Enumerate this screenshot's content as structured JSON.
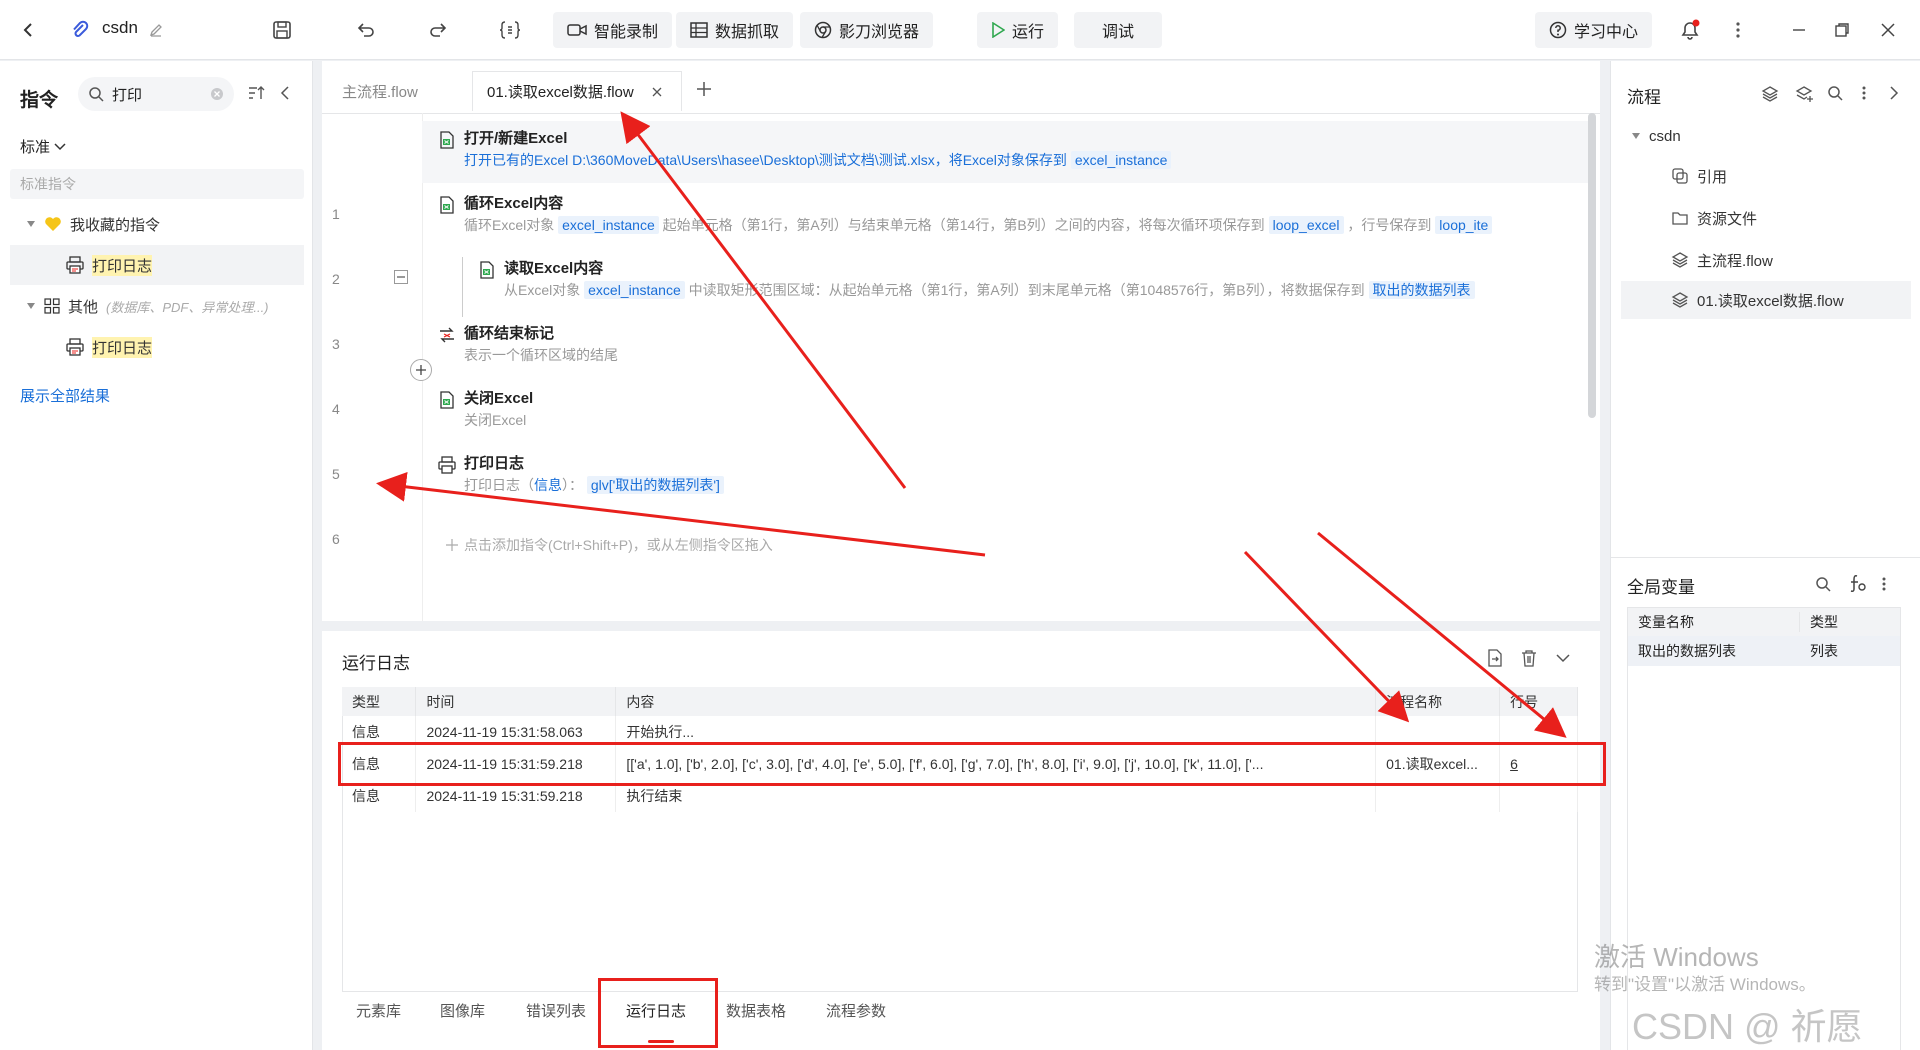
{
  "header": {
    "project_name": "csdn",
    "buttons": {
      "record": "智能录制",
      "data_capture": "数据抓取",
      "browser": "影刀浏览器",
      "run": "运行",
      "debug": "调试",
      "learn": "学习中心"
    }
  },
  "left": {
    "title": "指令",
    "search_value": "打印",
    "filter": "标准",
    "section_label": "标准指令",
    "favorites_label": "我收藏的指令",
    "fav_item": "打印日志",
    "other_label": "其他",
    "other_hint": "(数据库、PDF、异常处理...)",
    "other_item": "打印日志",
    "show_all": "展示全部结果"
  },
  "tabs": [
    {
      "label": "主流程.flow"
    },
    {
      "label": "01.读取excel数据.flow"
    }
  ],
  "steps": [
    {
      "num": "1",
      "title": "打开/新建Excel",
      "desc": "打开已有的Excel D:\\360MoveData\\Users\\hasee\\Desktop\\测试文档\\测试.xlsx，将Excel对象保存到",
      "var1": "excel_instance"
    },
    {
      "num": "2",
      "title": "循环Excel内容",
      "desc": "循环Excel对象",
      "var1": "excel_instance",
      "desc2": "起始单元格（第1行，第A列）与结束单元格（第14行，第B列）之间的内容，将每次循环项保存到",
      "var2": "loop_excel",
      "desc3": "，行号保存到",
      "var3": "loop_ite"
    },
    {
      "num": "3",
      "title": "读取Excel内容",
      "desc": "从Excel对象",
      "var1": "excel_instance",
      "desc2": "中读取矩形范围区域：从起始单元格（第1行，第A列）到末尾单元格（第1048576行，第B列），将数据保存到",
      "var2": "取出的数据列表"
    },
    {
      "num": "4",
      "title": "循环结束标记",
      "desc": "表示一个循环区域的结尾"
    },
    {
      "num": "5",
      "title": "关闭Excel",
      "desc": "关闭Excel"
    },
    {
      "num": "6",
      "title": "打印日志",
      "desc": "打印日志（",
      "var1": "信息",
      "desc2": "）：",
      "var2": "glv['取出的数据列表']"
    }
  ],
  "add_hint": "点击添加指令(Ctrl+Shift+P)，或从左侧指令区拖入",
  "log": {
    "title": "运行日志",
    "columns": [
      "类型",
      "时间",
      "内容",
      "流程名称",
      "行号"
    ],
    "rows": [
      {
        "type": "信息",
        "time": "2024-11-19 15:31:58.063",
        "content": "开始执行...",
        "flow": "",
        "line": ""
      },
      {
        "type": "信息",
        "time": "2024-11-19 15:31:59.218",
        "content": "[['a', 1.0], ['b', 2.0], ['c', 3.0], ['d', 4.0], ['e', 5.0], ['f', 6.0], ['g', 7.0], ['h', 8.0], ['i', 9.0], ['j', 10.0], ['k', 11.0], ['...",
        "flow": "01.读取excel...",
        "line": "6"
      },
      {
        "type": "信息",
        "time": "2024-11-19 15:31:59.218",
        "content": "执行结束",
        "flow": "",
        "line": ""
      }
    ]
  },
  "bottom_tabs": [
    "元素库",
    "图像库",
    "错误列表",
    "运行日志",
    "数据表格",
    "流程参数"
  ],
  "right": {
    "title": "流程",
    "root": "csdn",
    "items": [
      "引用",
      "资源文件",
      "主流程.flow",
      "01.读取excel数据.flow"
    ],
    "globals_title": "全局变量",
    "globals_columns": [
      "变量名称",
      "类型"
    ],
    "globals_rows": [
      {
        "name": "取出的数据列表",
        "type": "列表"
      }
    ]
  },
  "watermark": {
    "line1": "激活 Windows",
    "line2": "转到\"设置\"以激活 Windows。",
    "csdn": "CSDN @  祈愿"
  },
  "colors": {
    "accent": "#1a6fd8",
    "annotation_red": "#e8201c",
    "highlight": "#fff3b0"
  }
}
